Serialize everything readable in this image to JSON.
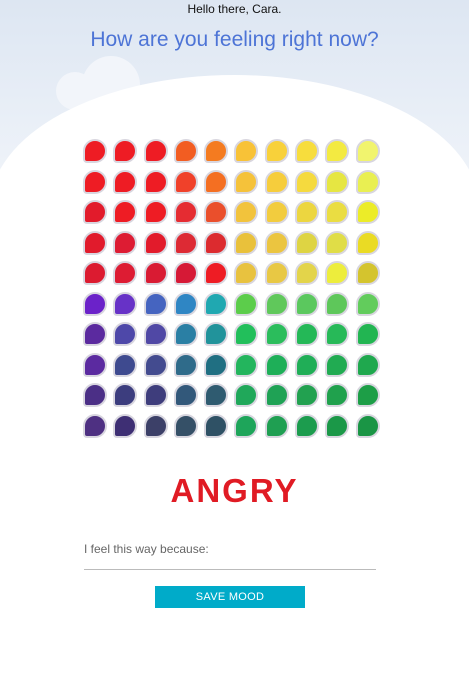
{
  "header": {
    "greeting": "Hello there, Cara.",
    "question": "How are you feeling right now?"
  },
  "mood_grid": {
    "rows": [
      [
        "#ee1c24",
        "#ee1c24",
        "#ee1c24",
        "#f25d22",
        "#f47b20",
        "#f8c237",
        "#f8d13a",
        "#f7dd3d",
        "#f3ea41",
        "#f1f46e"
      ],
      [
        "#ee1c24",
        "#ee1c24",
        "#ee1c24",
        "#f0412a",
        "#f46f22",
        "#f5c23a",
        "#f6cd3c",
        "#f5da3e",
        "#e6e642",
        "#e9ef52"
      ],
      [
        "#e21b2b",
        "#ee1c24",
        "#ee1c24",
        "#e52c32",
        "#ea4f2c",
        "#f2c33c",
        "#f2cc3e",
        "#ecd640",
        "#eadd42",
        "#ecec28"
      ],
      [
        "#e11b2c",
        "#dd1c33",
        "#e21b2b",
        "#dd2a34",
        "#dc2b2f",
        "#e9c13b",
        "#ebc540",
        "#ded443",
        "#e0dd47",
        "#eadb24"
      ],
      [
        "#dc1b30",
        "#dd1c33",
        "#d91b33",
        "#d61936",
        "#ee1c24",
        "#e8c23f",
        "#e8c844",
        "#e3d44a",
        "#eded3c",
        "#d4c42e"
      ],
      [
        "#6b22c9",
        "#6732c7",
        "#4564c0",
        "#2f86c4",
        "#20a8b1",
        "#5ccd4b",
        "#60c85b",
        "#5bc85e",
        "#5ec75a",
        "#62cc5c"
      ],
      [
        "#5b2a9f",
        "#4e48a9",
        "#5048a5",
        "#2a7fa4",
        "#21939b",
        "#22bf5b",
        "#2bbd5c",
        "#24b857",
        "#27b958",
        "#22b552"
      ],
      [
        "#5b2aa0",
        "#3e4a8f",
        "#434b8f",
        "#2f6b8a",
        "#206f82",
        "#23b55d",
        "#1eaf58",
        "#20ae57",
        "#21ab52",
        "#1fa84e"
      ],
      [
        "#4b2f86",
        "#3c3d7e",
        "#3e3d7c",
        "#32587a",
        "#2f5b70",
        "#20a85a",
        "#1fa255",
        "#22a150",
        "#20a14d",
        "#1d9e47"
      ],
      [
        "#4e3082",
        "#3e2f74",
        "#3c4068",
        "#355067",
        "#2f5165",
        "#1ea55a",
        "#1f9f52",
        "#1c9c4e",
        "#1b9848",
        "#1a9545"
      ]
    ]
  },
  "selected_mood": {
    "label": "ANGRY",
    "color": "#e01b24"
  },
  "reason": {
    "label": "I feel this way because:",
    "value": "",
    "placeholder": ""
  },
  "save_button": {
    "label": "SAVE MOOD"
  },
  "colors": {
    "title": "#4d74d6",
    "button": "#00abc9"
  }
}
